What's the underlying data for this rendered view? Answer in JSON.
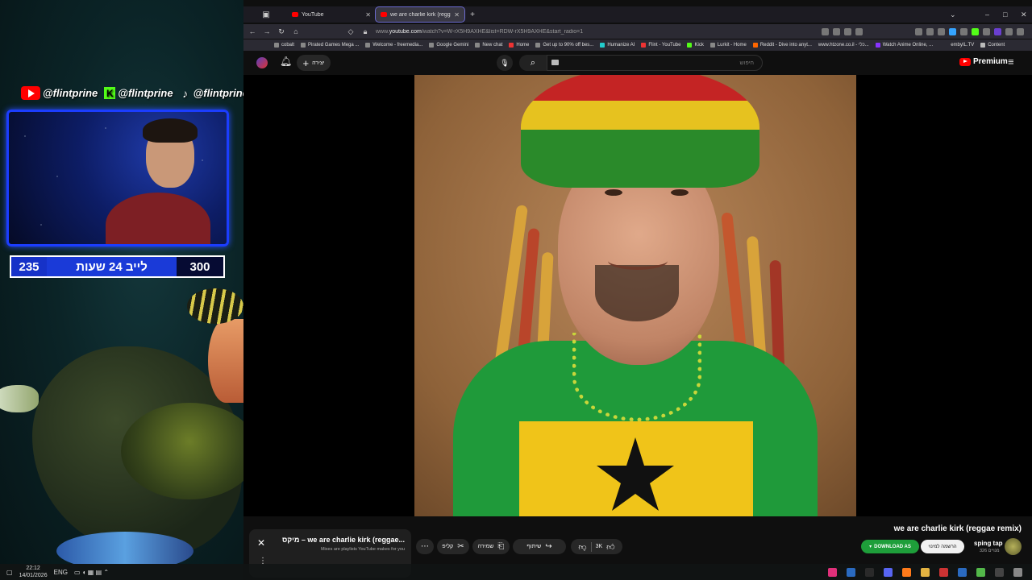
{
  "overlay": {
    "handles": [
      {
        "platform_icon": "youtube-icon",
        "handle": "@flintprine"
      },
      {
        "platform_icon": "kick-icon",
        "handle": "@flintprine"
      },
      {
        "platform_icon": "tiktok-icon",
        "handle": "@flintprine"
      }
    ],
    "counter": {
      "left": "235",
      "label": "לייב 24 שעות",
      "right": "300"
    }
  },
  "taskbar": {
    "lang": "ENG",
    "time": "22:12",
    "date": "14/01/2026"
  },
  "browser": {
    "tabs": [
      {
        "title": "YouTube",
        "active": false
      },
      {
        "title": "we are charlie kirk (reggae",
        "active": true
      }
    ],
    "url_prefix": "www.",
    "url_domain": "youtube.com",
    "url_rest": "/watch?v=W-rX5H9AXHE&list=RDW-rX5H9AXHE&start_radio=1",
    "bookmarks": [
      "cobalt",
      "Pirated Games Mega ...",
      "Welcome - freemedia...",
      "Google Gemini",
      "New chat",
      "Home",
      "Get up to 90% off bes...",
      "Humanize AI",
      "Flint - YouTube",
      "Kick",
      "Lurkit - Home",
      "Reddit - Dive into anyt...",
      "www.htzone.co.il - כלי...",
      "Watch Anime Online, ...",
      "embyIL.TV",
      "Content"
    ]
  },
  "youtube": {
    "create_label": "יצירה",
    "search_placeholder": "חיפוש",
    "premium_label": "Premium",
    "video_title": "we are charlie kirk (reggae remix)",
    "channel_name": "sping tap",
    "channel_subs": "326 מנויים",
    "subscribe_label": "הרשמה למינוי",
    "download_label": "DOWNLOAD AS",
    "likes": "3K",
    "share_label": "שיתוף",
    "save_label": "שמירה",
    "clip_label": "קליפ",
    "mix": {
      "title": "מיקס – we are charlie kirk (reggae...",
      "subtitle": "Mixes are playlists YouTube makes for you"
    }
  },
  "colors": {
    "yt_red": "#ff0000",
    "download_green": "#1e9e3a",
    "counter_blue": "#1632c8",
    "kick_green": "#53fc18"
  }
}
